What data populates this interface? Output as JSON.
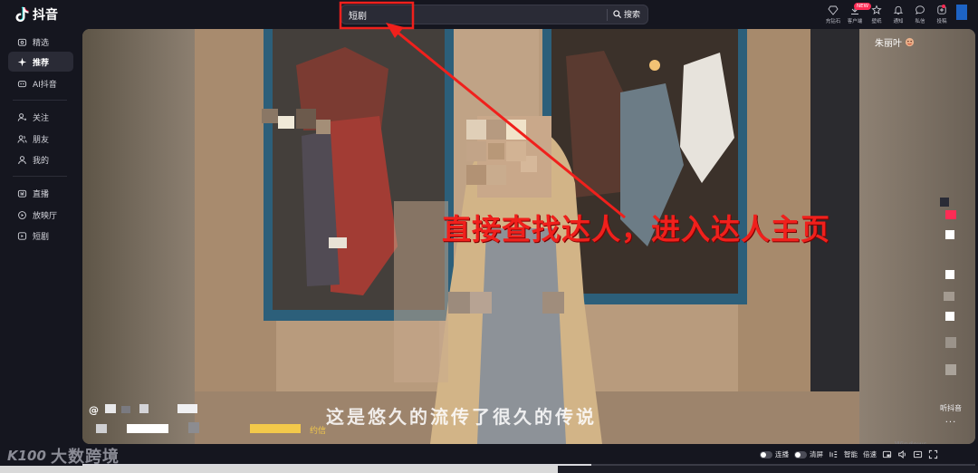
{
  "app": {
    "logo_text": "抖音"
  },
  "search": {
    "value": "短剧",
    "button_label": "搜索"
  },
  "top_actions": [
    {
      "label": "充钻石",
      "icon": "diamond-icon"
    },
    {
      "label": "客户端",
      "icon": "client-icon",
      "badge": "NEW"
    },
    {
      "label": "壁纸",
      "icon": "wallpaper-icon"
    },
    {
      "label": "通知",
      "icon": "bell-icon"
    },
    {
      "label": "私信",
      "icon": "message-icon"
    },
    {
      "label": "投稿",
      "icon": "upload-icon"
    }
  ],
  "sidebar": {
    "items": [
      {
        "label": "精选",
        "icon": "featured-icon",
        "active": false
      },
      {
        "label": "推荐",
        "icon": "sparkle-icon",
        "active": true
      },
      {
        "label": "AI抖音",
        "icon": "ai-icon",
        "active": false
      },
      {
        "label": "关注",
        "icon": "follow-icon",
        "active": false
      },
      {
        "label": "朋友",
        "icon": "friends-icon",
        "active": false
      },
      {
        "label": "我的",
        "icon": "profile-icon",
        "active": false
      },
      {
        "label": "直播",
        "icon": "live-icon",
        "active": false
      },
      {
        "label": "放映厅",
        "icon": "cinema-icon",
        "active": false
      },
      {
        "label": "短剧",
        "icon": "drama-icon",
        "active": false
      }
    ]
  },
  "video": {
    "author_name": "朱丽叶",
    "at_sign": "@",
    "subtitle": "这是悠久的流传了很久的传说",
    "desc_tail": "约信",
    "listen_label": "听抖音",
    "more": "···",
    "progress": 0.57
  },
  "controls": {
    "autoplay_label": "连播",
    "clear_label": "清屏",
    "quality_label": "智能",
    "speed_label": "倍速"
  },
  "annotation": {
    "text": "直接查找达人，进入达人主页",
    "color": "#f0201c"
  },
  "watermark": {
    "text": "大数跨境",
    "prefix": "K100"
  },
  "colors": {
    "accent": "#fe2c55",
    "background": "#15161f"
  }
}
